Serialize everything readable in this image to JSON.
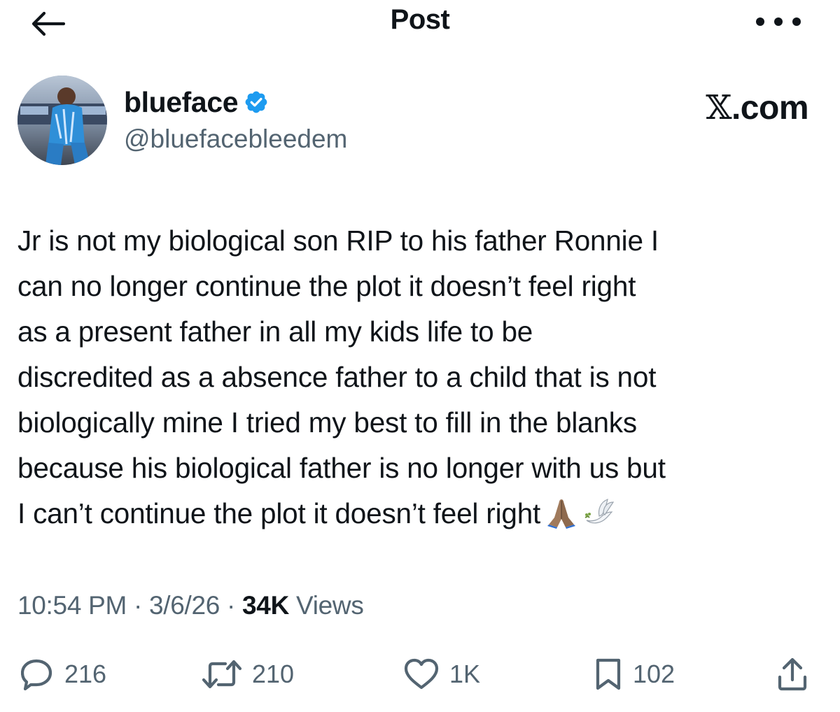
{
  "header": {
    "title": "Post",
    "back_icon": "arrow-left-icon",
    "more_icon": "more-horizontal-icon"
  },
  "author": {
    "display_name": "blueface",
    "verified": true,
    "handle": "@bluefacebleedem",
    "watermark_text": ".com",
    "watermark_x": "𝕏"
  },
  "post": {
    "text": "Jr is not my biological son RIP to his father Ronnie I\ncan no longer continue the plot it doesn’t feel right\nas a present father in all my kids life to be\ndiscredited as a absence father to a child that is not\nbiologically mine I tried my best to fill in the blanks\nbecause his biological father is no longer with us but\nI can’t continue the plot it doesn’t feel right",
    "emojis": [
      "folded-hands",
      "dove"
    ]
  },
  "meta": {
    "time": "10:54 PM",
    "separator": " · ",
    "date": "3/6/26",
    "views_count": "34K",
    "views_label": " Views"
  },
  "actions": {
    "reply_count": "216",
    "repost_count": "210",
    "like_count": "1K",
    "bookmark_count": "102"
  },
  "colors": {
    "text_primary": "#0f1419",
    "text_secondary": "#536471",
    "verified_blue": "#1d9bf0"
  }
}
